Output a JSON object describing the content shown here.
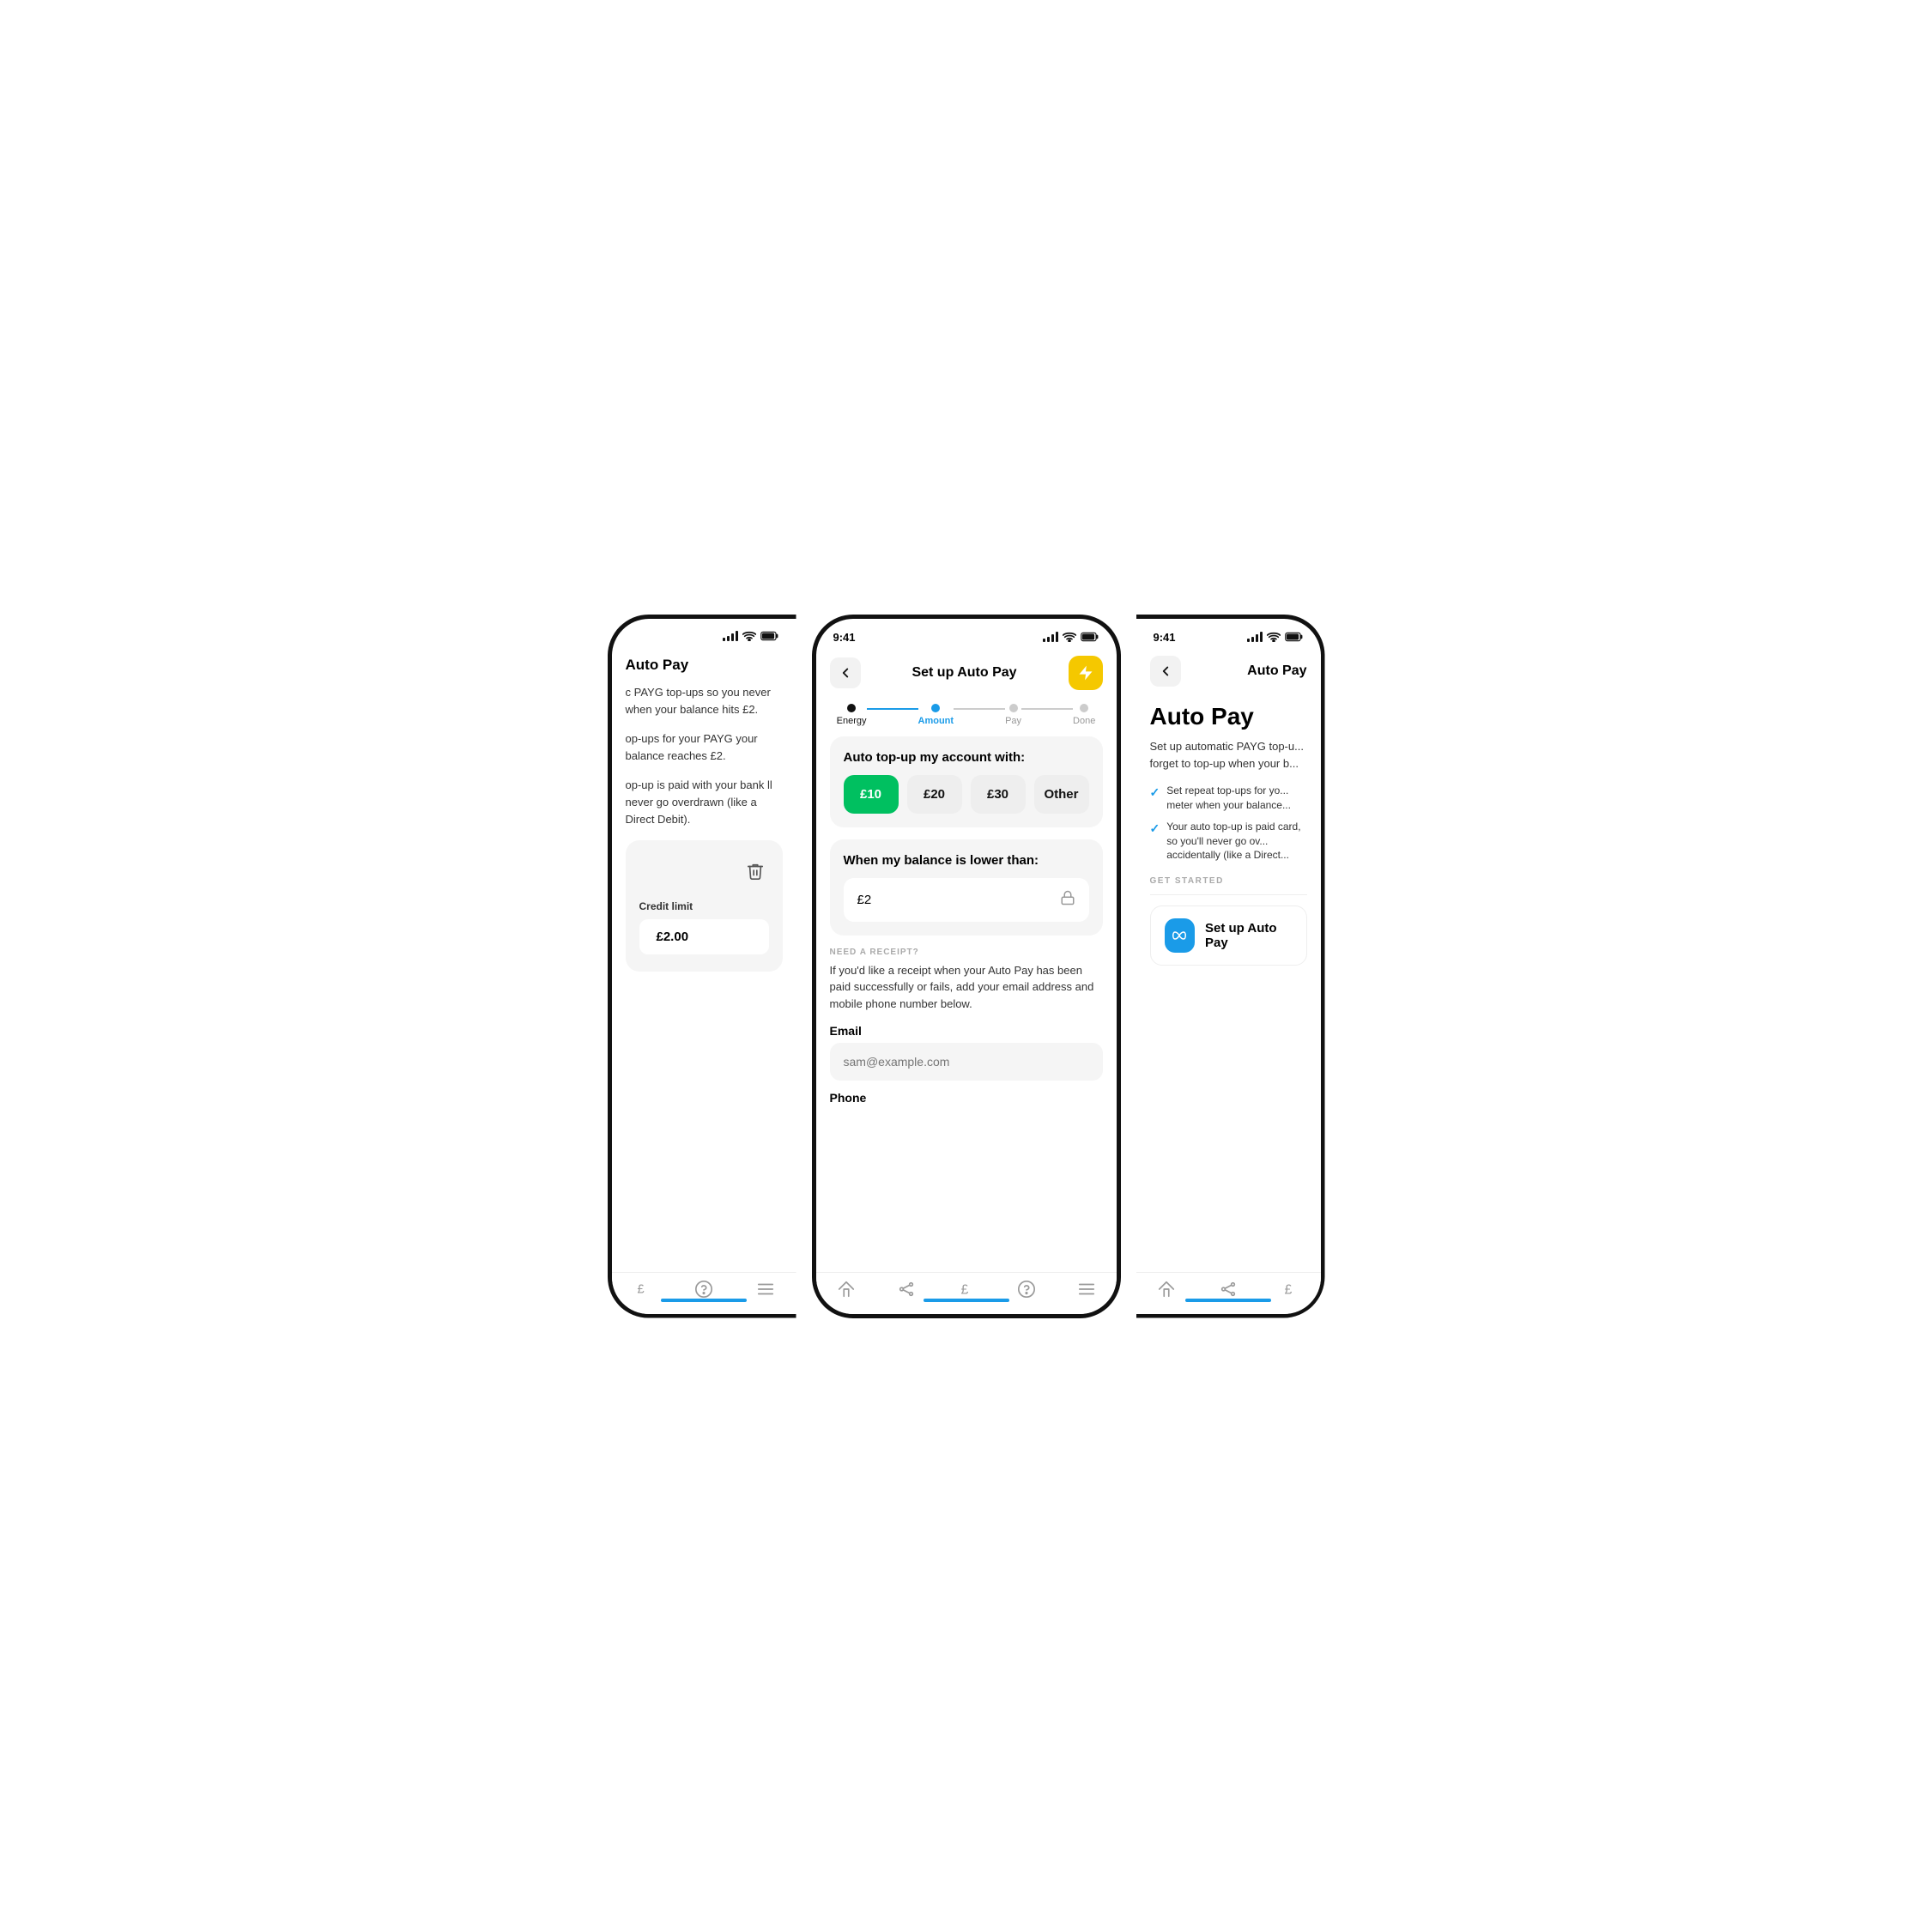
{
  "left_phone": {
    "page_title": "Auto Pay",
    "body_text_1": "c PAYG top-ups so you never when your balance hits £2.",
    "body_text_2": "op-ups for your PAYG your balance reaches £2.",
    "body_text_3": "op-up is paid with your bank ll never go overdrawn (like a Direct Debit).",
    "credit_limit_label": "Credit limit",
    "credit_limit_value": "£2.00",
    "nav_items": [
      "pound",
      "question",
      "menu"
    ]
  },
  "center_phone": {
    "status_time": "9:41",
    "header_title": "Set up Auto Pay",
    "stepper": {
      "steps": [
        "Energy",
        "Amount",
        "Pay",
        "Done"
      ],
      "active_index": 1
    },
    "auto_topup_title": "Auto top-up my account with:",
    "amounts": [
      "£10",
      "£20",
      "£30",
      "Other"
    ],
    "selected_amount_index": 0,
    "balance_title": "When my balance is lower than:",
    "balance_value": "£2",
    "receipt_section_label": "NEED A RECEIPT?",
    "receipt_text": "If you'd like a receipt when your Auto Pay has been paid successfully or fails, add your email address and mobile phone number below.",
    "email_label": "Email",
    "email_placeholder": "sam@example.com",
    "phone_label": "Phone",
    "nav_items": [
      "home",
      "connections",
      "pound",
      "question",
      "menu"
    ]
  },
  "right_phone": {
    "status_time": "9:41",
    "header_title": "Auto Pay",
    "page_title": "Auto Pay",
    "description": "Set up automatic PAYG top-u... forget to top-up when your b...",
    "features": [
      "Set repeat top-ups for yo... meter when your balance...",
      "Your auto top-up is paid card, so you'll never go ov... accidentally (like a Direct..."
    ],
    "get_started_label": "GET STARTED",
    "setup_button_label": "Set up Auto Pay",
    "nav_items": [
      "home",
      "connections",
      "pound"
    ]
  },
  "colors": {
    "accent_blue": "#1a9be8",
    "accent_green": "#00c060",
    "accent_yellow": "#f5c800",
    "tab_bar": "#1a9be8"
  }
}
